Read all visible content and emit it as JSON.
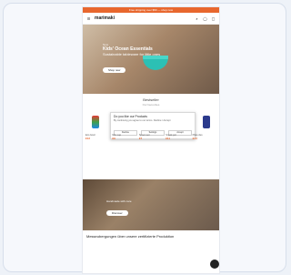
{
  "promo": {
    "text": "Free shipping over $50 — shop now"
  },
  "header": {
    "brand": "marimaki",
    "menu_icon": "menu-icon",
    "search_icon": "search-icon",
    "cart_icon": "cart-icon",
    "account_icon": "user-icon"
  },
  "hero": {
    "eyebrow": "New",
    "title": "Kids' Ocean Essentials",
    "subtitle": "Sustainable tableware for little ones",
    "cta": "Shop now"
  },
  "section": {
    "title": "Bestseller",
    "subtitle": "Our favourites"
  },
  "dialog": {
    "title": "Do you like our Products",
    "body": "By continuing you agree to our terms. Decline / Accept",
    "buttons": [
      "Decline",
      "Settings",
      "Accept"
    ]
  },
  "products": [
    {
      "name": "Eco bowl",
      "price": "€12"
    },
    {
      "name": "Mini cup",
      "price": "€9"
    },
    {
      "name": "Spoon set",
      "price": "€7"
    },
    {
      "name": "Snack pot",
      "price": "€11"
    },
    {
      "name": "Plate duo",
      "price": "€14"
    }
  ],
  "banner2": {
    "text": "Handmade with care",
    "cta": "Discover"
  },
  "headline": "Messeubergungen über unsere zertifizierte Produktion",
  "colors": {
    "accent": "#e8672e",
    "teal": "#2cc0b4"
  }
}
